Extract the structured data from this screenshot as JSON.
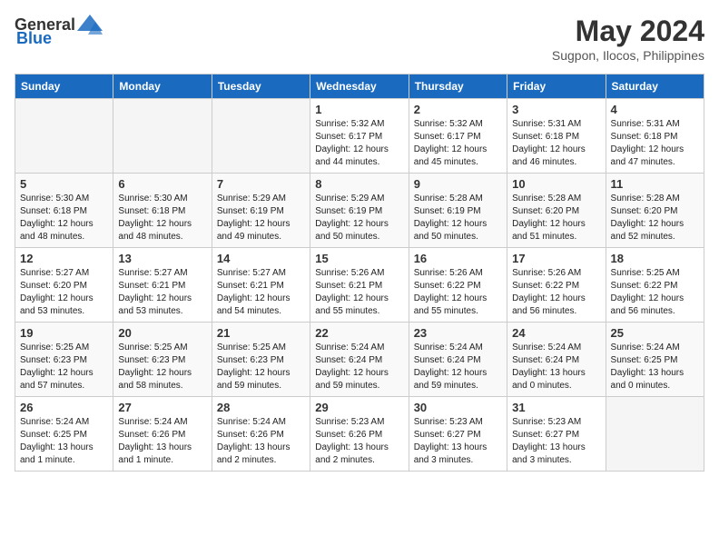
{
  "header": {
    "logo_general": "General",
    "logo_blue": "Blue",
    "month_year": "May 2024",
    "location": "Sugpon, Ilocos, Philippines"
  },
  "days_of_week": [
    "Sunday",
    "Monday",
    "Tuesday",
    "Wednesday",
    "Thursday",
    "Friday",
    "Saturday"
  ],
  "weeks": [
    [
      {
        "day": "",
        "info": ""
      },
      {
        "day": "",
        "info": ""
      },
      {
        "day": "",
        "info": ""
      },
      {
        "day": "1",
        "info": "Sunrise: 5:32 AM\nSunset: 6:17 PM\nDaylight: 12 hours\nand 44 minutes."
      },
      {
        "day": "2",
        "info": "Sunrise: 5:32 AM\nSunset: 6:17 PM\nDaylight: 12 hours\nand 45 minutes."
      },
      {
        "day": "3",
        "info": "Sunrise: 5:31 AM\nSunset: 6:18 PM\nDaylight: 12 hours\nand 46 minutes."
      },
      {
        "day": "4",
        "info": "Sunrise: 5:31 AM\nSunset: 6:18 PM\nDaylight: 12 hours\nand 47 minutes."
      }
    ],
    [
      {
        "day": "5",
        "info": "Sunrise: 5:30 AM\nSunset: 6:18 PM\nDaylight: 12 hours\nand 48 minutes."
      },
      {
        "day": "6",
        "info": "Sunrise: 5:30 AM\nSunset: 6:18 PM\nDaylight: 12 hours\nand 48 minutes."
      },
      {
        "day": "7",
        "info": "Sunrise: 5:29 AM\nSunset: 6:19 PM\nDaylight: 12 hours\nand 49 minutes."
      },
      {
        "day": "8",
        "info": "Sunrise: 5:29 AM\nSunset: 6:19 PM\nDaylight: 12 hours\nand 50 minutes."
      },
      {
        "day": "9",
        "info": "Sunrise: 5:28 AM\nSunset: 6:19 PM\nDaylight: 12 hours\nand 50 minutes."
      },
      {
        "day": "10",
        "info": "Sunrise: 5:28 AM\nSunset: 6:20 PM\nDaylight: 12 hours\nand 51 minutes."
      },
      {
        "day": "11",
        "info": "Sunrise: 5:28 AM\nSunset: 6:20 PM\nDaylight: 12 hours\nand 52 minutes."
      }
    ],
    [
      {
        "day": "12",
        "info": "Sunrise: 5:27 AM\nSunset: 6:20 PM\nDaylight: 12 hours\nand 53 minutes."
      },
      {
        "day": "13",
        "info": "Sunrise: 5:27 AM\nSunset: 6:21 PM\nDaylight: 12 hours\nand 53 minutes."
      },
      {
        "day": "14",
        "info": "Sunrise: 5:27 AM\nSunset: 6:21 PM\nDaylight: 12 hours\nand 54 minutes."
      },
      {
        "day": "15",
        "info": "Sunrise: 5:26 AM\nSunset: 6:21 PM\nDaylight: 12 hours\nand 55 minutes."
      },
      {
        "day": "16",
        "info": "Sunrise: 5:26 AM\nSunset: 6:22 PM\nDaylight: 12 hours\nand 55 minutes."
      },
      {
        "day": "17",
        "info": "Sunrise: 5:26 AM\nSunset: 6:22 PM\nDaylight: 12 hours\nand 56 minutes."
      },
      {
        "day": "18",
        "info": "Sunrise: 5:25 AM\nSunset: 6:22 PM\nDaylight: 12 hours\nand 56 minutes."
      }
    ],
    [
      {
        "day": "19",
        "info": "Sunrise: 5:25 AM\nSunset: 6:23 PM\nDaylight: 12 hours\nand 57 minutes."
      },
      {
        "day": "20",
        "info": "Sunrise: 5:25 AM\nSunset: 6:23 PM\nDaylight: 12 hours\nand 58 minutes."
      },
      {
        "day": "21",
        "info": "Sunrise: 5:25 AM\nSunset: 6:23 PM\nDaylight: 12 hours\nand 59 minutes."
      },
      {
        "day": "22",
        "info": "Sunrise: 5:24 AM\nSunset: 6:24 PM\nDaylight: 12 hours\nand 59 minutes."
      },
      {
        "day": "23",
        "info": "Sunrise: 5:24 AM\nSunset: 6:24 PM\nDaylight: 12 hours\nand 59 minutes."
      },
      {
        "day": "24",
        "info": "Sunrise: 5:24 AM\nSunset: 6:24 PM\nDaylight: 13 hours\nand 0 minutes."
      },
      {
        "day": "25",
        "info": "Sunrise: 5:24 AM\nSunset: 6:25 PM\nDaylight: 13 hours\nand 0 minutes."
      }
    ],
    [
      {
        "day": "26",
        "info": "Sunrise: 5:24 AM\nSunset: 6:25 PM\nDaylight: 13 hours\nand 1 minute."
      },
      {
        "day": "27",
        "info": "Sunrise: 5:24 AM\nSunset: 6:26 PM\nDaylight: 13 hours\nand 1 minute."
      },
      {
        "day": "28",
        "info": "Sunrise: 5:24 AM\nSunset: 6:26 PM\nDaylight: 13 hours\nand 2 minutes."
      },
      {
        "day": "29",
        "info": "Sunrise: 5:23 AM\nSunset: 6:26 PM\nDaylight: 13 hours\nand 2 minutes."
      },
      {
        "day": "30",
        "info": "Sunrise: 5:23 AM\nSunset: 6:27 PM\nDaylight: 13 hours\nand 3 minutes."
      },
      {
        "day": "31",
        "info": "Sunrise: 5:23 AM\nSunset: 6:27 PM\nDaylight: 13 hours\nand 3 minutes."
      },
      {
        "day": "",
        "info": ""
      }
    ]
  ]
}
